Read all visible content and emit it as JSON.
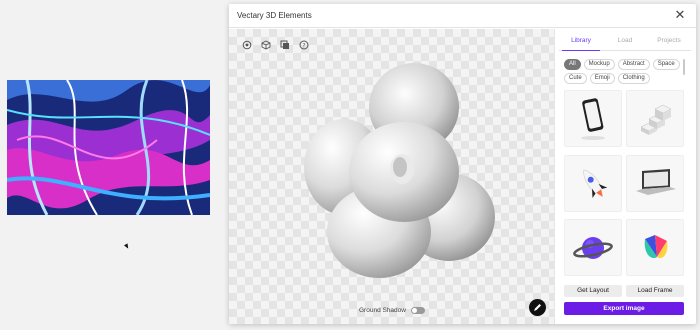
{
  "dialog": {
    "title": "Vectary 3D Elements",
    "close_icon": "close-icon"
  },
  "canvas": {
    "toolbar_icons": [
      "orbit-icon",
      "cube-icon",
      "layers-icon",
      "help-icon"
    ],
    "ground_shadow_label": "Ground Shadow",
    "ground_shadow_enabled": false
  },
  "panel": {
    "tabs": [
      {
        "label": "Library",
        "active": true
      },
      {
        "label": "Load",
        "active": false
      },
      {
        "label": "Projects",
        "active": false
      }
    ],
    "filters": [
      {
        "label": "All",
        "active": true
      },
      {
        "label": "Mockup",
        "active": false
      },
      {
        "label": "Abstract",
        "active": false
      },
      {
        "label": "Space",
        "active": false
      },
      {
        "label": "Cute",
        "active": false
      },
      {
        "label": "Emoji",
        "active": false
      },
      {
        "label": "Clothing",
        "active": false
      }
    ],
    "items": [
      "phone-mockup",
      "cubes-stairs",
      "rocket",
      "laptop-mockup",
      "planet",
      "abstract-shape"
    ],
    "get_layout_label": "Get Layout",
    "load_frame_label": "Load Frame",
    "export_label": "Export image"
  },
  "colors": {
    "accent": "#6b1de6",
    "tab_active": "#6b3af5"
  }
}
